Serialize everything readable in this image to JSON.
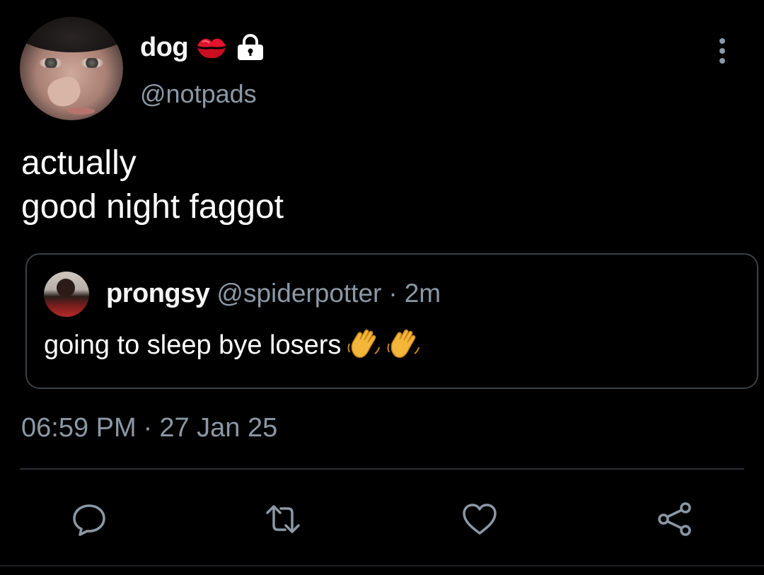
{
  "author": {
    "display_name": "dog",
    "handle": "@notpads",
    "badge_icons": [
      "kiss-mark-icon",
      "lock-icon"
    ]
  },
  "tweet": {
    "lines": [
      "actually",
      "good night faggot"
    ]
  },
  "quoted_tweet": {
    "display_name": "prongsy",
    "handle": "@spiderpotter",
    "separator": "·",
    "time": "2m",
    "text": "going to sleep bye losers",
    "emoji_icons": [
      "waving-hand-icon",
      "waving-hand-icon"
    ]
  },
  "timestamp": {
    "time": "06:59 PM",
    "separator": "·",
    "date": "27 Jan 25"
  },
  "actions": [
    "reply-icon",
    "retweet-icon",
    "like-icon",
    "share-icon"
  ],
  "colors": {
    "background": "#000000",
    "text": "#ffffff",
    "muted": "#8b98a5",
    "border": "#3a4046",
    "kiss": "#e0142a",
    "emoji": "#f4b63a"
  }
}
